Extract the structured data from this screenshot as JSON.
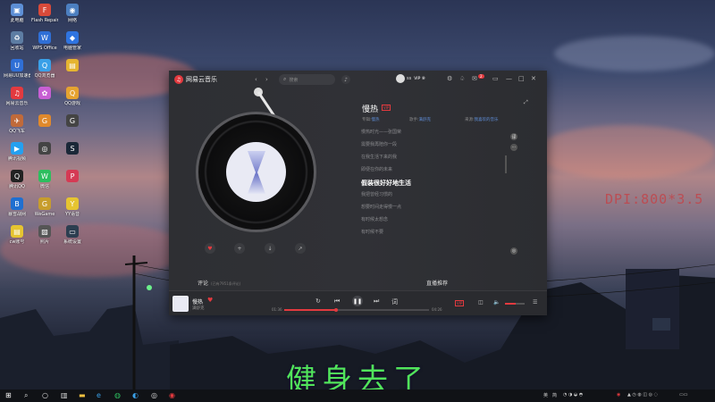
{
  "desktop": {
    "icons": [
      {
        "label": "此电脑",
        "glyph": "▣",
        "color": "#5d8fd6"
      },
      {
        "label": "Flash Repair",
        "glyph": "F",
        "color": "#d84a3a"
      },
      {
        "label": "网络",
        "glyph": "◉",
        "color": "#4c7fc0"
      },
      {
        "label": "回收站",
        "glyph": "♻",
        "color": "#5d7da3"
      },
      {
        "label": "WPS Office",
        "glyph": "W",
        "color": "#2f6fd6"
      },
      {
        "label": "电脑管家",
        "glyph": "◆",
        "color": "#2f74e0"
      },
      {
        "label": "网易UU加速器",
        "glyph": "U",
        "color": "#2f6fd6"
      },
      {
        "label": "QQ浏览器",
        "glyph": "Q",
        "color": "#3aa0e8"
      },
      {
        "label": "",
        "glyph": "▤",
        "color": "#e6b430"
      },
      {
        "label": "网易云音乐",
        "glyph": "♫",
        "color": "#e33a3f"
      },
      {
        "label": "",
        "glyph": "✿",
        "color": "#c85fd4"
      },
      {
        "label": "QQ游戏",
        "glyph": "Q",
        "color": "#e6a330"
      },
      {
        "label": "QQ飞车",
        "glyph": "✈",
        "color": "#c06a3a"
      },
      {
        "label": "",
        "glyph": "G",
        "color": "#e0892c"
      },
      {
        "label": "",
        "glyph": "G",
        "color": "#444"
      },
      {
        "label": "腾讯视频",
        "glyph": "▶",
        "color": "#24a0f0"
      },
      {
        "label": "",
        "glyph": "◎",
        "color": "#444"
      },
      {
        "label": "",
        "glyph": "S",
        "color": "#1b2838"
      },
      {
        "label": "腾讯QQ",
        "glyph": "Q",
        "color": "#222"
      },
      {
        "label": "微信",
        "glyph": "W",
        "color": "#2dbe5f"
      },
      {
        "label": "",
        "glyph": "P",
        "color": "#d53a54"
      },
      {
        "label": "暴雪战网",
        "glyph": "B",
        "color": "#1f6fd0"
      },
      {
        "label": "WeGame",
        "glyph": "G",
        "color": "#c79d2d"
      },
      {
        "label": "YY语音",
        "glyph": "Y",
        "color": "#e6c430"
      },
      {
        "label": "cw账号",
        "glyph": "▤",
        "color": "#e6c430"
      },
      {
        "label": "照片",
        "glyph": "▨",
        "color": "#555"
      },
      {
        "label": "系统设置",
        "glyph": "▭",
        "color": "#2c3e50"
      }
    ]
  },
  "watermark": "DPI:800*3.5",
  "subtitle": "健身去了",
  "app": {
    "name": "网易云音乐",
    "search_placeholder": "搜索",
    "user": "ss",
    "vip": "VIP ⑧",
    "badge_count": "2"
  },
  "song": {
    "title": "慢热",
    "tag": "VIP",
    "album_label": "专辑:",
    "album": "慢热",
    "singer_label": "歌手:",
    "singer": "满舒克",
    "source_label": "来源:",
    "source": "我喜欢的音乐"
  },
  "lyrics": {
    "lines": [
      "慢热时光——张国荣",
      "需要我再陪你一段",
      "在我生活下来的我",
      "即便在你的未来",
      "假装很好好地生活",
      "我把曾经习惯的",
      "想要时间走得慢一点",
      "有时候太想念",
      "有时候不要"
    ],
    "current_index": 4
  },
  "sections": {
    "comments": "评论",
    "comments_count": "(已有7951条评论)",
    "recommend": "直播推荐"
  },
  "player": {
    "title": "慢热",
    "artist": "满舒克",
    "time_current": "01:36",
    "time_total": "04:26",
    "progress": 0.36,
    "quality": "VIP",
    "volume": 0.55
  },
  "taskbar": {
    "tray_lang": "英",
    "tray_ime": "简"
  },
  "colors": {
    "accent": "#e33a3f",
    "subtitle": "#51e45a",
    "watermark": "#c2454a"
  }
}
